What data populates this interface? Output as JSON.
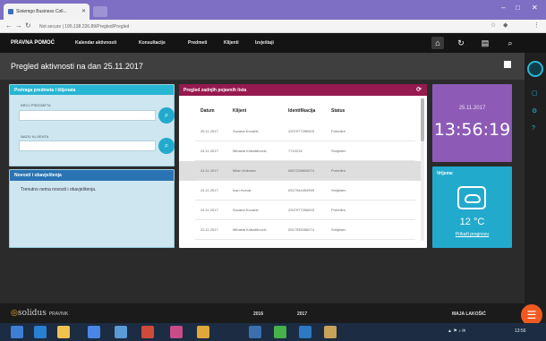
{
  "browser": {
    "tab_title": "Sistemgo Business Coll...",
    "tab_close": "✕",
    "url": "Not secure | 195.138.226.89/Pregled/Pregled",
    "window_controls": [
      "–",
      "□",
      "✕"
    ]
  },
  "app": {
    "brand": "PRAVNA POMOĆ",
    "menu": [
      "Kalendar aktivnosti",
      "Konsultacije",
      "Predmeti",
      "Klijenti",
      "Izvještaji"
    ],
    "header_icons": [
      "home-icon",
      "refresh-icon",
      "document-icon",
      "search-icon"
    ]
  },
  "page": {
    "title": "Pregled aktivnosti na dan 25.11.2017"
  },
  "search_panel": {
    "title": "Pretraga predmeta i klijenata",
    "field1_label": "BROJ PREDMETA",
    "field1_placeholder": "",
    "field2_label": "NAZIV KLIJENTA",
    "field2_placeholder": ""
  },
  "news_panel": {
    "title": "Novosti i obavještenja",
    "body": "Trenutno nema novosti i obavještenja."
  },
  "table_panel": {
    "title": "Pregled zadnjih pojavnih lista",
    "columns": [
      "Datum",
      "Klijent",
      "Identifikacija",
      "Status"
    ],
    "rows": [
      {
        "date": "25.11.2017",
        "client": "Suzana Kovačić",
        "id": "2207977256503",
        "status": "Potvrđen",
        "selected": false
      },
      {
        "date": "24.11.2017",
        "client": "Mihaela Kobašlinović",
        "id": "7710215",
        "status": "Smiješen",
        "selected": false
      },
      {
        "date": "24.11.2017",
        "client": "Milan Križanec",
        "id": "0807228829074",
        "status": "Potvrđen",
        "selected": true
      },
      {
        "date": "24.11.2017",
        "client": "Ivan Horvat",
        "id": "0917944494959",
        "status": "Smiješen",
        "selected": false
      },
      {
        "date": "24.11.2017",
        "client": "Suzana Kovačić",
        "id": "2207977256503",
        "status": "Potvrđen",
        "selected": false
      },
      {
        "date": "22.11.2017",
        "client": "Mihaela Kobašlinović",
        "id": "0917935056074",
        "status": "Smiješen",
        "selected": false
      }
    ]
  },
  "clock": {
    "date": "25.11.2017",
    "time": "13:56:19"
  },
  "weather": {
    "title": "Vrijeme",
    "temperature": "12 °C",
    "link": "Prikaži prognozu"
  },
  "footer": {
    "logo_text": "solidus",
    "logo_suffix": "PRAVNIK",
    "items": [
      "2016",
      "2017"
    ],
    "user": "MAJA LAKOŠIĆ"
  },
  "colors": {
    "accent_cyan": "#27b6d3",
    "table_header": "#951a4f",
    "clock_bg": "#8d5bb6",
    "news_header": "#2a74b4",
    "fab": "#f05a22"
  }
}
